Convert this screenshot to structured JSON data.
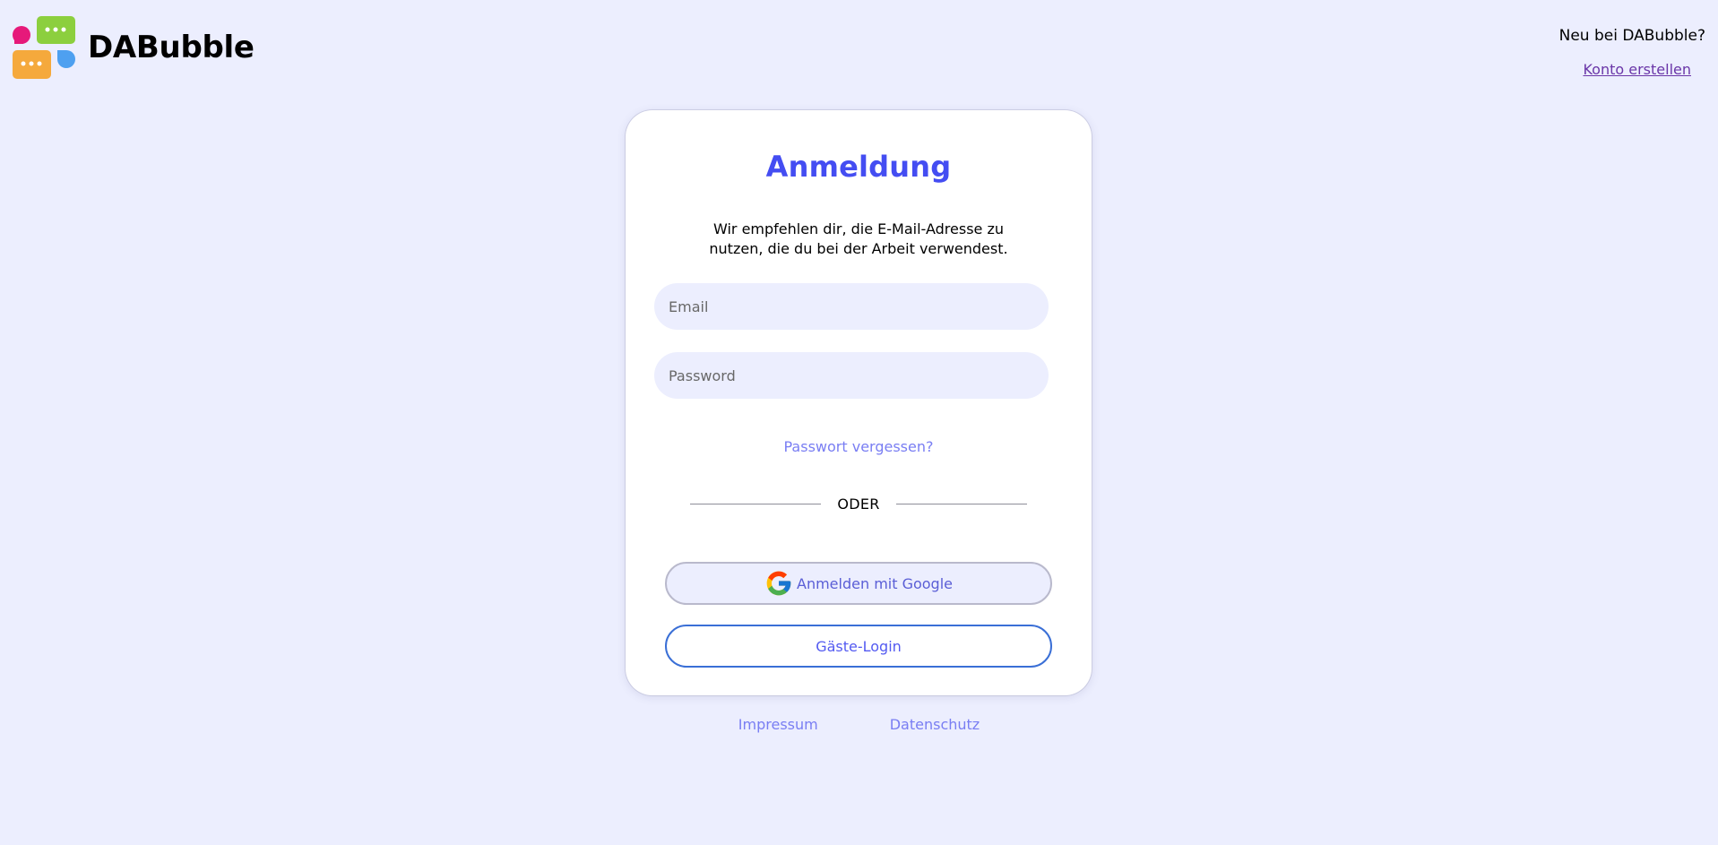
{
  "brand": {
    "name": "DABubble"
  },
  "signup": {
    "question": "Neu bei DABubble?",
    "create_account": "Konto erstellen"
  },
  "login": {
    "title": "Anmeldung",
    "intro": "Wir empfehlen dir, die E-Mail-Adresse zu nutzen, die du bei der Arbeit verwendest.",
    "email_placeholder": "Email",
    "password_placeholder": "Password",
    "forgot": "Passwort vergessen?",
    "divider": "ODER",
    "google_button": "Anmelden mit Google",
    "guest_button": "Gäste-Login"
  },
  "footer": {
    "impressum": "Impressum",
    "datenschutz": "Datenschutz"
  },
  "colors": {
    "background": "#eceefe",
    "accent": "#444df2",
    "link": "#797ef3"
  },
  "icons": {
    "logo": "dabubble-logo-icon",
    "google": "google-icon"
  }
}
